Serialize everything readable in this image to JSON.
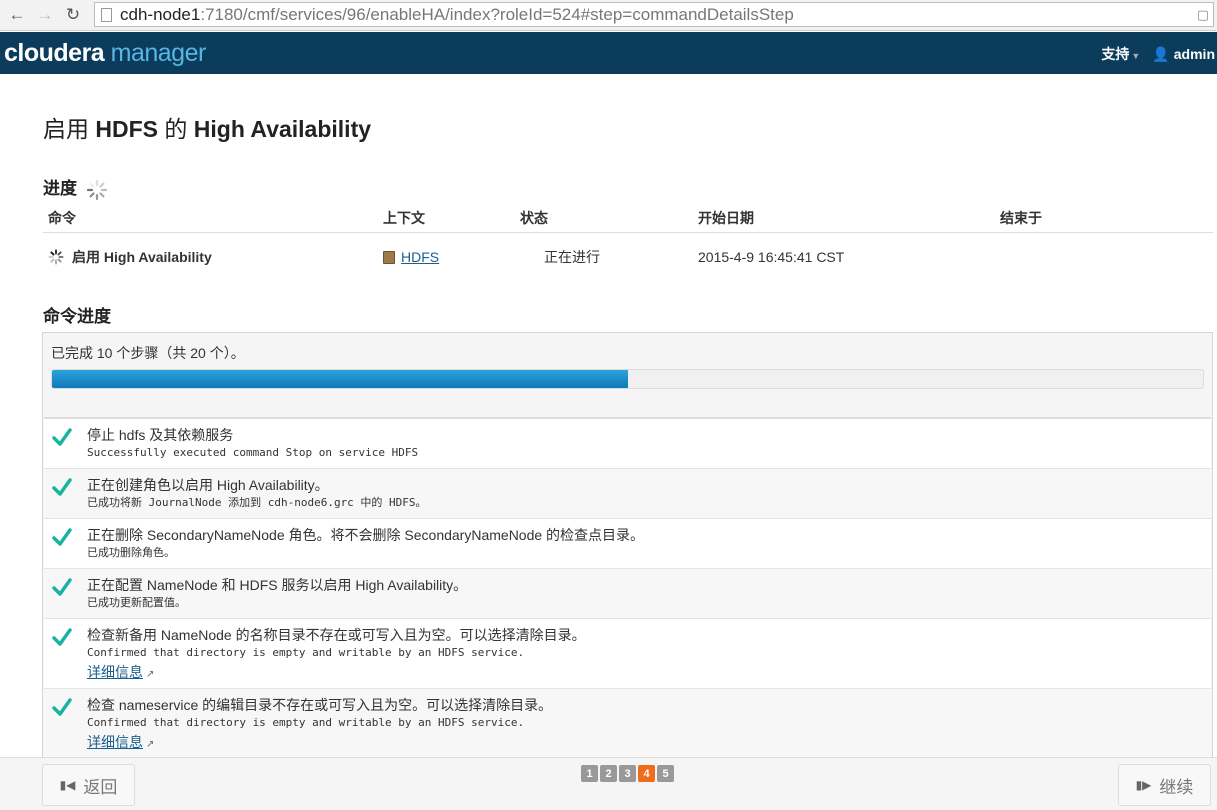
{
  "browser": {
    "url_host": "cdh-node1",
    "url_path": ":7180/cmf/services/96/enableHA/index?roleId=524#step=commandDetailsStep"
  },
  "header": {
    "logo_part1": "cloudera",
    "logo_part2": " manager",
    "support_label": "支持",
    "user_label": "admin"
  },
  "page": {
    "title_prefix": "启用 ",
    "title_bold1": "HDFS",
    "title_mid": " 的 ",
    "title_bold2": "High Availability"
  },
  "progress_section": {
    "title": "进度",
    "columns": [
      "命令",
      "上下文",
      "状态",
      "开始日期",
      "结束于"
    ],
    "row": {
      "command": "启用 High Availability",
      "context": "HDFS",
      "state": "正在进行",
      "start": "2015-4-9 16:45:41 CST",
      "end": ""
    }
  },
  "command_progress": {
    "title": "命令进度",
    "summary": "已完成 10 个步骤（共 20 个）。",
    "completed": 10,
    "total": 20,
    "steps": [
      {
        "title": "停止 hdfs 及其依赖服务",
        "msg": "Successfully executed command Stop on service HDFS",
        "detail": ""
      },
      {
        "title": "正在创建角色以启用 High Availability。",
        "msg": "已成功将新 JournalNode 添加到 cdh-node6.grc 中的 HDFS。",
        "detail": ""
      },
      {
        "title": "正在删除 SecondaryNameNode 角色。将不会删除 SecondaryNameNode 的检查点目录。",
        "msg": "已成功删除角色。",
        "detail": ""
      },
      {
        "title": "正在配置 NameNode 和 HDFS 服务以启用 High Availability。",
        "msg": "已成功更新配置值。",
        "detail": ""
      },
      {
        "title": "检查新备用 NameNode 的名称目录不存在或可写入且为空。可以选择清除目录。",
        "msg": "Confirmed that directory is empty and writable by an HDFS service.",
        "detail": "详细信息"
      },
      {
        "title": "检查 nameservice 的编辑目录不存在或可写入且为空。可以选择清除目录。",
        "msg": "Confirmed that directory is empty and writable by an HDFS service.",
        "detail": "详细信息"
      }
    ]
  },
  "footer": {
    "back_label": "返回",
    "next_label": "继续",
    "pages": [
      "1",
      "2",
      "3",
      "4",
      "5"
    ],
    "current_page": "4"
  },
  "colors": {
    "header_bg": "#0c3c5b",
    "logo_accent": "#56b6e6",
    "progress_fill": "#1a8fd0",
    "check": "#19b3a2",
    "pager_active": "#ef6c1a"
  }
}
